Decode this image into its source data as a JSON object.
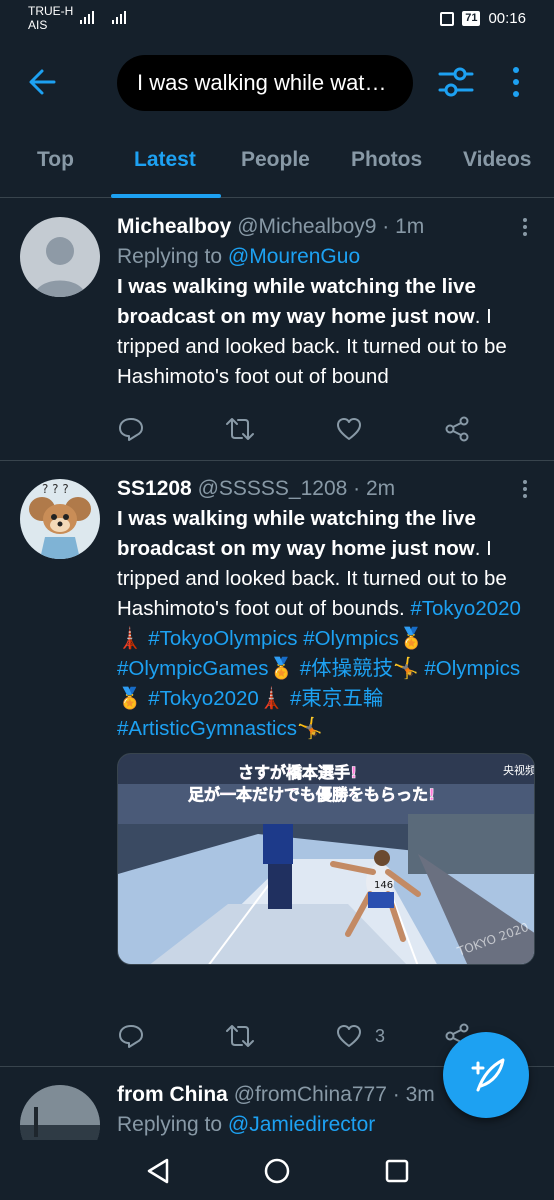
{
  "status_bar": {
    "carrier_line1": "TRUE-H",
    "carrier_line2": "AIS",
    "battery": "71",
    "time": "00:16"
  },
  "search": {
    "query": "I was walking while watching the live broadcast on my way home just now"
  },
  "tabs": [
    {
      "label": "Top",
      "active": false
    },
    {
      "label": "Latest",
      "active": true
    },
    {
      "label": "People",
      "active": false
    },
    {
      "label": "Photos",
      "active": false
    },
    {
      "label": "Videos",
      "active": false
    }
  ],
  "tweets": [
    {
      "name": "Michealboy",
      "handle": "@Michealboy9",
      "time": "· 1m",
      "replying_prefix": "Replying to ",
      "replying_to": "@MourenGuo",
      "bold_text": "I was walking while watching the live broadcast on my way home just now",
      "text": ". I tripped and looked back. It turned out to be Hashimoto's foot out of bound",
      "likes": ""
    },
    {
      "name": "SS1208",
      "handle": "@SSSSS_1208",
      "time": "· 2m",
      "bold_text": "I was walking while watching the live broadcast on my way home just now",
      "text": ". I tripped and looked back. It turned out to be Hashimoto's foot out of bounds.",
      "hashtags": {
        "h1": "#Tokyo2020",
        "e1": "🗼",
        "h2": "#TokyoOlympics",
        "h3": "#Olympics",
        "e3": "🏅",
        "h4": "#OlympicGames",
        "e4": "🏅",
        "h5": "#体操競技",
        "e5": "🤸",
        "h6": "#Olympics",
        "e6": "🏅",
        "h7": "#Tokyo2020",
        "e7": "🗼",
        "h8": "#東京五輪",
        "h9": "#ArtisticGymnastics",
        "e9": "🤸"
      },
      "media": {
        "caption_line1": "さすが橋本選手!",
        "caption_line2": "足が一本だけでも優勝をもらった!",
        "bib": "146",
        "corner": "央视频",
        "banner": "TOKYO 2020"
      },
      "likes": "3"
    },
    {
      "name": "from China",
      "handle": "@fromChina777",
      "time": "· 3m",
      "replying_prefix": "Replying to ",
      "replying_to": "@Jamiedirector"
    }
  ],
  "colors": {
    "background": "#15202b",
    "accent": "#1da1f2",
    "secondary_text": "#8899a6",
    "divider": "#38444d"
  }
}
